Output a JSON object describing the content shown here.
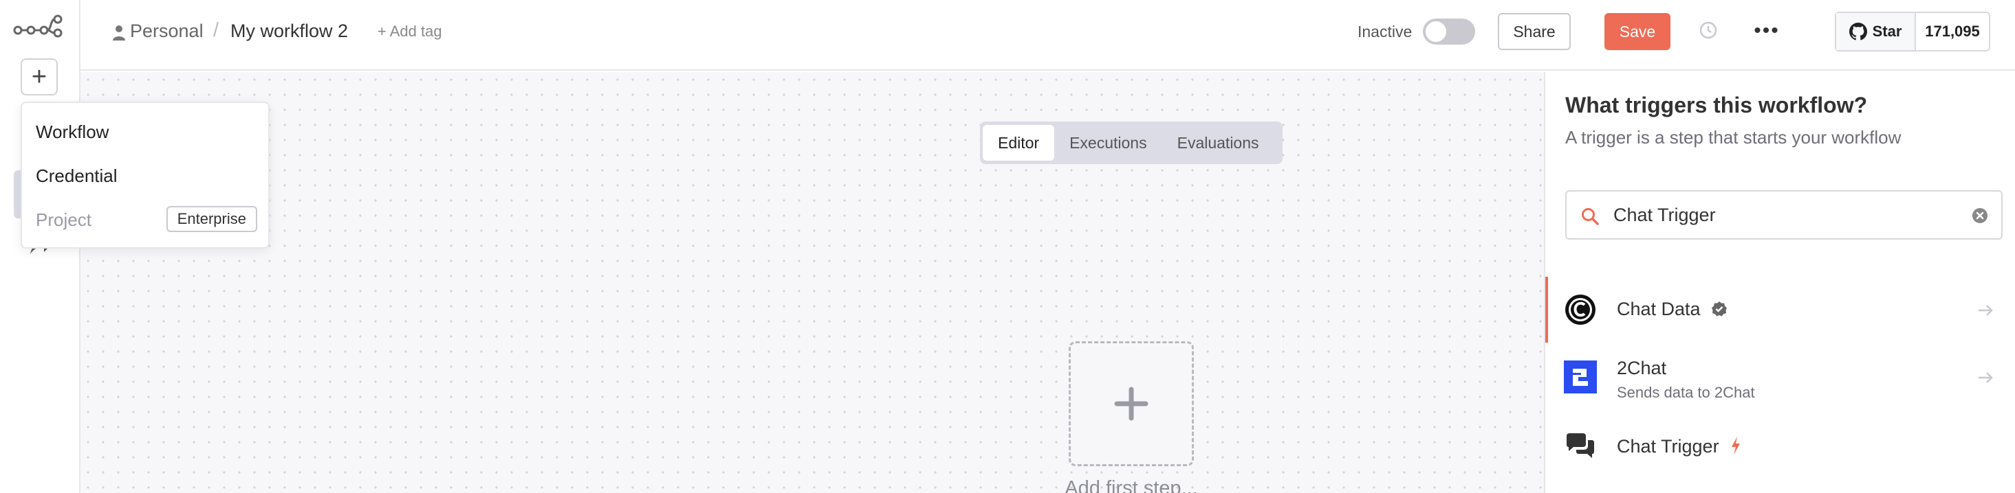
{
  "header": {
    "breadcrumb_project": "Personal",
    "breadcrumb_separator": "/",
    "workflow_title": "My workflow 2",
    "add_tag_label": "+ Add tag",
    "status_label": "Inactive",
    "share_label": "Share",
    "save_label": "Save",
    "github_star_label": "Star",
    "github_star_count": "171,095"
  },
  "create_menu": {
    "items": [
      {
        "label": "Workflow"
      },
      {
        "label": "Credential"
      },
      {
        "label": "Project",
        "badge": "Enterprise"
      }
    ]
  },
  "tabs": [
    {
      "label": "Editor",
      "active": true
    },
    {
      "label": "Executions",
      "active": false
    },
    {
      "label": "Evaluations",
      "active": false
    }
  ],
  "canvas": {
    "add_first_step_label": "Add first step..."
  },
  "trigger_panel": {
    "title": "What triggers this workflow?",
    "subtitle": "A trigger is a step that starts your workflow",
    "search_value": "Chat Trigger",
    "results": [
      {
        "name": "Chat Data",
        "description": "",
        "icon": "chat-data-logo"
      },
      {
        "name": "2Chat",
        "description": "Sends data to 2Chat",
        "icon": "2chat-logo"
      },
      {
        "name": "Chat Trigger",
        "description": "",
        "icon": "chat-bubbles-icon"
      }
    ]
  },
  "colors": {
    "accent": "#ee6b55",
    "toggle_off": "#c9c9cf",
    "tabs_bg": "#dcdce6",
    "brand_2chat": "#2a4cf0"
  }
}
